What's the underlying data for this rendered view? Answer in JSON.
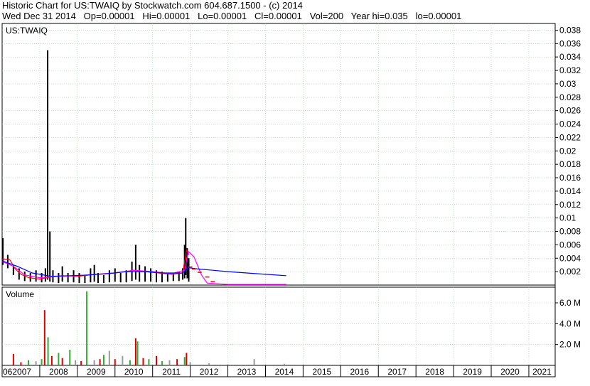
{
  "header": {
    "line1": "Historic Chart for US:TWAIQ by Stockwatch.com 604.687.1500 - (c) 2014",
    "line2": "Wed Dec 31 2014   Op=0.00001   Hi=0.00001   Lo=0.00001   Cl=0.00001   Vol=200   Year hi=0.035   lo=0.00001"
  },
  "colors": {
    "price_bar": "#000000",
    "ma_short": "#ff0000",
    "ma_mid": "#ff00ff",
    "ma_long": "#0000ff",
    "vol_up": "#33aa33",
    "vol_down": "#dd0000",
    "vol_flat": "#999999",
    "grid": "#99cc99"
  },
  "chart_data": [
    {
      "type": "line",
      "title": "US:TWAIQ",
      "ylim": [
        0,
        0.039
      ],
      "yticks": [
        "0.002",
        "0.004",
        "0.006",
        "0.008",
        "0.01",
        "0.012",
        "0.014",
        "0.016",
        "0.018",
        "0.02",
        "0.022",
        "0.024",
        "0.026",
        "0.028",
        "0.03",
        "0.032",
        "0.034",
        "0.036",
        "0.038"
      ],
      "xlim": [
        2007.0,
        2021.7
      ],
      "xticks": [
        "062007",
        "2008",
        "2009",
        "2010",
        "2011",
        "2012",
        "2013",
        "2014",
        "2015",
        "2016",
        "2017",
        "2018",
        "2019",
        "2020",
        "2021"
      ],
      "grid": true,
      "price_series": [
        {
          "x": 2007.02,
          "high": 0.007,
          "low": 0.003
        },
        {
          "x": 2007.15,
          "high": 0.0045,
          "low": 0.0025
        },
        {
          "x": 2007.3,
          "high": 0.003,
          "low": 0.0015
        },
        {
          "x": 2007.45,
          "high": 0.0025,
          "low": 0.0008
        },
        {
          "x": 2007.6,
          "high": 0.002,
          "low": 0.0006
        },
        {
          "x": 2007.75,
          "high": 0.0018,
          "low": 0.0005
        },
        {
          "x": 2007.9,
          "high": 0.0022,
          "low": 0.0005
        },
        {
          "x": 2008.05,
          "high": 0.0018,
          "low": 0.0004
        },
        {
          "x": 2008.15,
          "high": 0.0025,
          "low": 0.0005
        },
        {
          "x": 2008.21,
          "high": 0.035,
          "low": 0.0008
        },
        {
          "x": 2008.27,
          "high": 0.008,
          "low": 0.0005
        },
        {
          "x": 2008.35,
          "high": 0.0022,
          "low": 0.0004
        },
        {
          "x": 2008.5,
          "high": 0.0018,
          "low": 0.0003
        },
        {
          "x": 2008.6,
          "high": 0.0028,
          "low": 0.0005
        },
        {
          "x": 2008.75,
          "high": 0.0018,
          "low": 0.0004
        },
        {
          "x": 2008.9,
          "high": 0.0022,
          "low": 0.0004
        },
        {
          "x": 2009.05,
          "high": 0.0018,
          "low": 0.0003
        },
        {
          "x": 2009.2,
          "high": 0.0015,
          "low": 0.0003
        },
        {
          "x": 2009.35,
          "high": 0.0025,
          "low": 0.0004
        },
        {
          "x": 2009.45,
          "high": 0.003,
          "low": 0.0005
        },
        {
          "x": 2009.55,
          "high": 0.0018,
          "low": 0.0003
        },
        {
          "x": 2009.7,
          "high": 0.0015,
          "low": 0.0003
        },
        {
          "x": 2009.85,
          "high": 0.0022,
          "low": 0.0004
        },
        {
          "x": 2010.0,
          "high": 0.0025,
          "low": 0.0005
        },
        {
          "x": 2010.15,
          "high": 0.0018,
          "low": 0.0004
        },
        {
          "x": 2010.3,
          "high": 0.0022,
          "low": 0.0004
        },
        {
          "x": 2010.45,
          "high": 0.0035,
          "low": 0.0006
        },
        {
          "x": 2010.55,
          "high": 0.006,
          "low": 0.0008
        },
        {
          "x": 2010.65,
          "high": 0.003,
          "low": 0.0005
        },
        {
          "x": 2010.8,
          "high": 0.0028,
          "low": 0.0005
        },
        {
          "x": 2010.95,
          "high": 0.0025,
          "low": 0.0005
        },
        {
          "x": 2011.1,
          "high": 0.0022,
          "low": 0.0004
        },
        {
          "x": 2011.25,
          "high": 0.002,
          "low": 0.0004
        },
        {
          "x": 2011.4,
          "high": 0.0018,
          "low": 0.0005
        },
        {
          "x": 2011.55,
          "high": 0.0018,
          "low": 0.0006
        },
        {
          "x": 2011.7,
          "high": 0.002,
          "low": 0.0006
        },
        {
          "x": 2011.8,
          "high": 0.0025,
          "low": 0.0008
        },
        {
          "x": 2011.85,
          "high": 0.006,
          "low": 0.001
        },
        {
          "x": 2011.88,
          "high": 0.01,
          "low": 0.0015
        },
        {
          "x": 2011.92,
          "high": 0.0055,
          "low": 0.001
        },
        {
          "x": 2011.96,
          "high": 0.004,
          "low": 0.0005
        }
      ],
      "series": [
        {
          "points": [
            [
              2007.0,
              0.0038
            ],
            [
              2007.2,
              0.0038
            ],
            [
              2007.35,
              0.0024
            ],
            [
              2007.5,
              0.0016
            ],
            [
              2007.7,
              0.0011
            ],
            [
              2008.0,
              0.0009
            ],
            [
              2008.3,
              0.0012
            ],
            [
              2008.6,
              0.0014
            ],
            [
              2009.0,
              0.0013
            ],
            [
              2009.5,
              0.0016
            ],
            [
              2010.0,
              0.0018
            ],
            [
              2010.5,
              0.0022
            ],
            [
              2011.0,
              0.0019
            ],
            [
              2011.5,
              0.0016
            ],
            [
              2011.8,
              0.0018
            ],
            [
              2011.9,
              0.0052
            ],
            [
              2011.97,
              0.0045
            ]
          ]
        },
        {
          "points": [
            [
              2007.0,
              0.0035
            ],
            [
              2007.3,
              0.0028
            ],
            [
              2007.6,
              0.0015
            ],
            [
              2008.0,
              0.0011
            ],
            [
              2008.5,
              0.0013
            ],
            [
              2009.0,
              0.0014
            ],
            [
              2009.5,
              0.0016
            ],
            [
              2010.0,
              0.0018
            ],
            [
              2010.5,
              0.0022
            ],
            [
              2011.0,
              0.002
            ],
            [
              2011.5,
              0.0017
            ],
            [
              2011.85,
              0.0022
            ],
            [
              2011.95,
              0.005
            ],
            [
              2012.1,
              0.0042
            ],
            [
              2012.3,
              0.0015
            ],
            [
              2012.45,
              0.0003
            ],
            [
              2013.0,
              0.0001
            ],
            [
              2014.0,
              0.0001
            ],
            [
              2014.55,
              0.0001
            ]
          ]
        },
        {
          "points": [
            [
              2007.0,
              0.0036
            ],
            [
              2007.4,
              0.0028
            ],
            [
              2007.8,
              0.0018
            ],
            [
              2008.3,
              0.0013
            ],
            [
              2008.8,
              0.0014
            ],
            [
              2009.3,
              0.0015
            ],
            [
              2009.8,
              0.0017
            ],
            [
              2010.3,
              0.002
            ],
            [
              2010.8,
              0.002
            ],
            [
              2011.3,
              0.0018
            ],
            [
              2011.8,
              0.0018
            ],
            [
              2011.95,
              0.0026
            ],
            [
              2012.2,
              0.0024
            ],
            [
              2012.6,
              0.0022
            ],
            [
              2013.0,
              0.002
            ],
            [
              2013.5,
              0.0018
            ],
            [
              2014.0,
              0.0016
            ],
            [
              2014.55,
              0.0014
            ]
          ]
        }
      ],
      "dashes": [
        [
          2012.0,
          0.0027
        ],
        [
          2012.1,
          0.0024
        ],
        [
          2012.25,
          0.0019
        ],
        [
          2012.45,
          0.0012
        ],
        [
          2012.6,
          0.0005
        ]
      ]
    },
    {
      "type": "bar",
      "title": "Volume",
      "ylim": [
        0,
        7.5
      ],
      "yticks": [
        "2.0 M",
        "4.0 M",
        "6.0 M"
      ],
      "grid": true,
      "bars": [
        {
          "x": 2007.3,
          "v": 1.1,
          "c": "down"
        },
        {
          "x": 2007.5,
          "v": 0.3,
          "c": "down"
        },
        {
          "x": 2007.7,
          "v": 0.5,
          "c": "up"
        },
        {
          "x": 2007.9,
          "v": 0.4,
          "c": "flat"
        },
        {
          "x": 2008.05,
          "v": 0.6,
          "c": "up"
        },
        {
          "x": 2008.13,
          "v": 5.3,
          "c": "down"
        },
        {
          "x": 2008.22,
          "v": 2.7,
          "c": "up"
        },
        {
          "x": 2008.32,
          "v": 0.9,
          "c": "down"
        },
        {
          "x": 2008.5,
          "v": 1.2,
          "c": "up"
        },
        {
          "x": 2008.6,
          "v": 0.7,
          "c": "down"
        },
        {
          "x": 2008.8,
          "v": 1.5,
          "c": "up"
        },
        {
          "x": 2008.95,
          "v": 0.5,
          "c": "flat"
        },
        {
          "x": 2009.1,
          "v": 0.4,
          "c": "down"
        },
        {
          "x": 2009.25,
          "v": 7.1,
          "c": "up"
        },
        {
          "x": 2009.45,
          "v": 0.5,
          "c": "flat"
        },
        {
          "x": 2009.6,
          "v": 0.6,
          "c": "down"
        },
        {
          "x": 2009.7,
          "v": 1.0,
          "c": "up"
        },
        {
          "x": 2009.85,
          "v": 1.4,
          "c": "flat"
        },
        {
          "x": 2010.0,
          "v": 0.6,
          "c": "down"
        },
        {
          "x": 2010.2,
          "v": 0.9,
          "c": "flat"
        },
        {
          "x": 2010.4,
          "v": 0.5,
          "c": "up"
        },
        {
          "x": 2010.55,
          "v": 2.6,
          "c": "down"
        },
        {
          "x": 2010.6,
          "v": 2.3,
          "c": "up"
        },
        {
          "x": 2010.75,
          "v": 0.7,
          "c": "down"
        },
        {
          "x": 2010.9,
          "v": 0.6,
          "c": "up"
        },
        {
          "x": 2011.1,
          "v": 0.9,
          "c": "down"
        },
        {
          "x": 2011.25,
          "v": 0.4,
          "c": "up"
        },
        {
          "x": 2011.45,
          "v": 0.5,
          "c": "flat"
        },
        {
          "x": 2011.65,
          "v": 0.6,
          "c": "down"
        },
        {
          "x": 2011.85,
          "v": 0.8,
          "c": "up"
        },
        {
          "x": 2011.9,
          "v": 1.2,
          "c": "down"
        },
        {
          "x": 2012.0,
          "v": 0.3,
          "c": "flat"
        },
        {
          "x": 2012.5,
          "v": 0.2,
          "c": "flat"
        },
        {
          "x": 2013.0,
          "v": 0.1,
          "c": "flat"
        },
        {
          "x": 2013.7,
          "v": 0.6,
          "c": "flat"
        },
        {
          "x": 2014.5,
          "v": 0.15,
          "c": "flat"
        }
      ]
    }
  ]
}
